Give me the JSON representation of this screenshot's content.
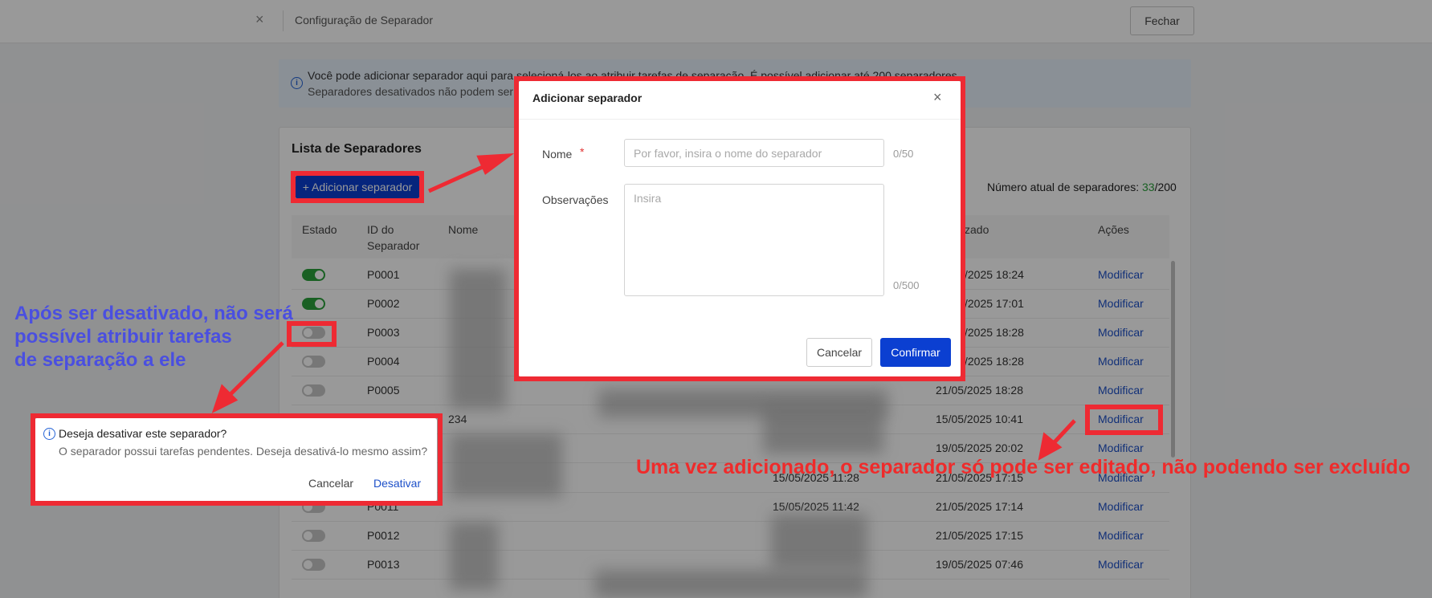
{
  "topbar": {
    "close_icon": "×",
    "title": "Configuração de Separador",
    "close_button": "Fechar"
  },
  "banner": {
    "line1": "Você pode adicionar separador aqui para selecioná-los ao atribuir tarefas de separação. É possível adicionar até 200 separadores.",
    "line2": "Separadores desativados não podem ser"
  },
  "list": {
    "title": "Lista de Separadores",
    "add_button": "+ Adicionar separador",
    "count_label": "Número atual de separadores: ",
    "count_current": "33",
    "count_max": "/200",
    "columns": {
      "estado": "Estado",
      "id_line1": "ID do",
      "id_line2": "Separador",
      "nome": "Nome",
      "atualizado": "zado",
      "acoes": "Ações"
    },
    "rows": [
      {
        "enabled": true,
        "id": "P0001",
        "nome": "",
        "criado": "",
        "atualizado": "/2025 18:24",
        "acao": "Modificar"
      },
      {
        "enabled": true,
        "id": "P0002",
        "nome": "",
        "criado": "",
        "atualizado": "/2025 17:01",
        "acao": "Modificar"
      },
      {
        "enabled": false,
        "id": "P0003",
        "nome": "",
        "criado": "",
        "atualizado": "/2025 18:28",
        "acao": "Modificar"
      },
      {
        "enabled": false,
        "id": "P0004",
        "nome": "",
        "criado": "",
        "atualizado": "/2025 18:28",
        "acao": "Modificar"
      },
      {
        "enabled": false,
        "id": "P0005",
        "nome": "",
        "criado": "",
        "atualizado": "21/05/2025 18:28",
        "acao": "Modificar"
      },
      {
        "enabled": null,
        "id": "",
        "nome": "234",
        "criado": "",
        "atualizado": "15/05/2025 10:41",
        "acao": "Modificar"
      },
      {
        "enabled": null,
        "id": "",
        "nome": "",
        "criado": "",
        "atualizado": "19/05/2025 20:02",
        "acao": "Modificar"
      },
      {
        "enabled": null,
        "id": "",
        "nome": "",
        "criado": "15/05/2025 11:28",
        "atualizado": "21/05/2025 17:15",
        "acao": "Modificar"
      },
      {
        "enabled": false,
        "id": "P0011",
        "nome": "",
        "criado": "15/05/2025 11:42",
        "atualizado": "21/05/2025 17:14",
        "acao": "Modificar"
      },
      {
        "enabled": false,
        "id": "P0012",
        "nome": "",
        "criado": "",
        "atualizado": "21/05/2025 17:15",
        "acao": "Modificar"
      },
      {
        "enabled": false,
        "id": "P0013",
        "nome": "",
        "criado": "",
        "atualizado": "19/05/2025 07:46",
        "acao": "Modificar"
      }
    ]
  },
  "modal": {
    "title": "Adicionar separador",
    "close_icon": "×",
    "nome_label": "Nome",
    "required_mark": "*",
    "nome_placeholder": "Por favor, insira o nome do separador",
    "nome_counter": "0/50",
    "obs_label": "Observações",
    "obs_placeholder": "Insira",
    "obs_counter": "0/500",
    "cancel_button": "Cancelar",
    "confirm_button": "Confirmar"
  },
  "popconfirm": {
    "info_icon": "i",
    "title": "Deseja desativar este separador?",
    "description": "O separador possui tarefas pendentes. Deseja desativá-lo mesmo assim?",
    "cancel": "Cancelar",
    "confirm": "Desativar"
  },
  "annotations": {
    "blue_line1": "Após ser desativado, não será",
    "blue_line2": "possível atribuir tarefas",
    "blue_line3": "de separação a ele",
    "red": "Uma vez adicionado, o separador só pode ser editado, não podendo ser excluído"
  },
  "colors": {
    "primary": "#0b3fd1",
    "link": "#1d50c9",
    "toggle_on": "#2aa13b",
    "annotation_red": "#ee2a33",
    "annotation_blue": "#4a4fe0"
  }
}
